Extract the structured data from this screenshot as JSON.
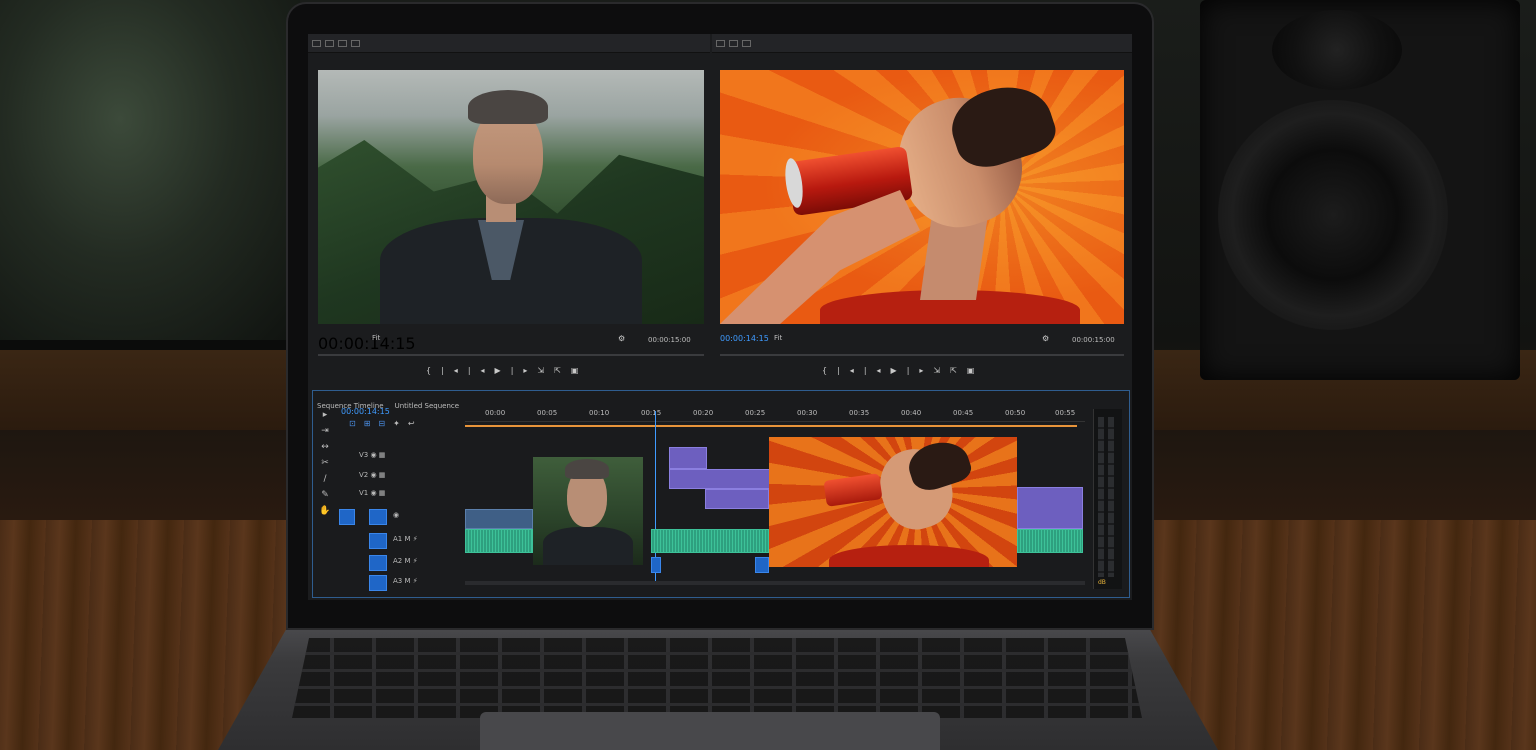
{
  "app": {
    "source_monitor": {
      "timecode": "00:00:14:15",
      "timecode_right": "00:00:15:00",
      "fit_label": "Fit"
    },
    "program_monitor": {
      "timecode": "00:00:14:15",
      "timecode_right": "00:00:15:00",
      "fit_label": "Fit"
    },
    "sequence": {
      "panel_title": "Sequence Timeline",
      "tab_title": "Untitled Sequence",
      "timecode": "00:00:14:15",
      "ruler_marks": [
        "00:00",
        "00:05",
        "00:10",
        "00:15",
        "00:20",
        "00:25",
        "00:30",
        "00:35",
        "00:40",
        "00:45",
        "00:50",
        "00:55"
      ]
    },
    "tracks": [
      {
        "name": "V3"
      },
      {
        "name": "V2"
      },
      {
        "name": "V1"
      },
      {
        "name": "A1"
      },
      {
        "name": "A2"
      },
      {
        "name": "A3"
      }
    ],
    "meter_label": "dB"
  },
  "colors": {
    "accent_blue": "#3f9bff",
    "clip_video": "#6d5fbf",
    "clip_audio": "#2ea07f",
    "playhead": "#e8943a"
  }
}
